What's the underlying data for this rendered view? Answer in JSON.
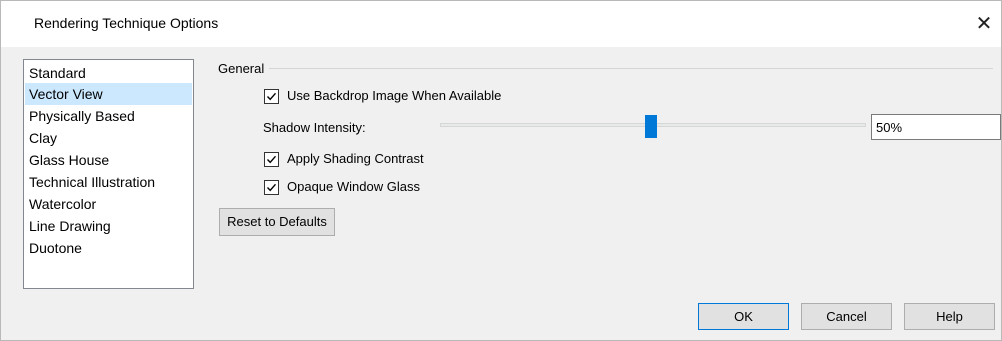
{
  "window": {
    "title": "Rendering Technique Options",
    "close_icon": "close-icon"
  },
  "techniques": [
    {
      "label": "Standard",
      "selected": false
    },
    {
      "label": "Vector View",
      "selected": true
    },
    {
      "label": "Physically Based",
      "selected": false
    },
    {
      "label": "Clay",
      "selected": false
    },
    {
      "label": "Glass House",
      "selected": false
    },
    {
      "label": "Technical Illustration",
      "selected": false
    },
    {
      "label": "Watercolor",
      "selected": false
    },
    {
      "label": "Line Drawing",
      "selected": false
    },
    {
      "label": "Duotone",
      "selected": false
    }
  ],
  "general": {
    "group_label": "General",
    "use_backdrop": {
      "label": "Use Backdrop Image When Available",
      "checked": true
    },
    "shadow_intensity": {
      "label": "Shadow Intensity:",
      "value": "50%",
      "level": 0.5
    },
    "apply_shading": {
      "label": "Apply Shading Contrast",
      "checked": true
    },
    "opaque_glass": {
      "label": "Opaque Window Glass",
      "checked": true
    },
    "reset_label": "Reset to Defaults"
  },
  "buttons": {
    "ok": "OK",
    "cancel": "Cancel",
    "help": "Help"
  },
  "colors": {
    "selection": "#cce8ff",
    "accent": "#0078d7"
  }
}
